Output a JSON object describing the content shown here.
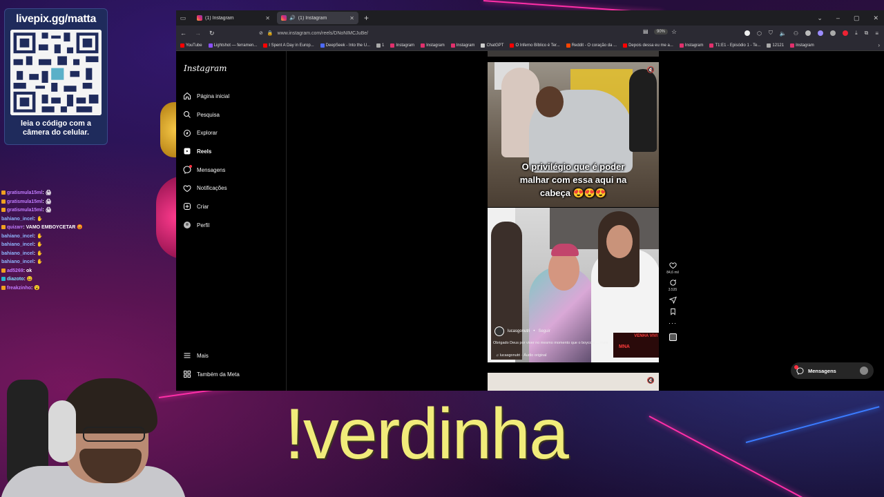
{
  "qr_panel": {
    "url": "livepix.gg/matta",
    "caption": "leia o código com a câmera do celular."
  },
  "chat": [
    {
      "user": "gratismula15ml",
      "sep": ": ",
      "msg": "🖨",
      "color": "purple"
    },
    {
      "user": "gratismula15ml",
      "sep": ": ",
      "msg": "🖨",
      "color": "purple"
    },
    {
      "user": "gratismula15ml",
      "sep": ": ",
      "msg": "🖨",
      "color": "purple"
    },
    {
      "user": "bahiano_incel",
      "sep": ": ",
      "msg": "✋",
      "color": "blue"
    },
    {
      "user": "quizarr",
      "sep": ": ",
      "msg": "VAMO EMBOYCETAR 😡",
      "color": "purple"
    },
    {
      "user": "bahiano_incel",
      "sep": ": ",
      "msg": "✋",
      "color": "blue"
    },
    {
      "user": "bahiano_incel",
      "sep": ": ",
      "msg": "✋",
      "color": "blue"
    },
    {
      "user": "bahiano_incel",
      "sep": ": ",
      "msg": "✋",
      "color": "blue"
    },
    {
      "user": "bahiano_incel",
      "sep": ": ",
      "msg": "✋",
      "color": "blue"
    },
    {
      "user": "ad5269",
      "sep": ": ",
      "msg": "ok",
      "color": "purple"
    },
    {
      "user": "diazoto",
      "sep": ": ",
      "msg": "😀",
      "color": "cyan"
    },
    {
      "user": "freakzinho",
      "sep": ": ",
      "msg": "😮",
      "color": "purple"
    }
  ],
  "browser": {
    "tabs": [
      {
        "title": "(1) Instagram",
        "active": false
      },
      {
        "title": "(1) Instagram",
        "active": true
      }
    ],
    "url": "www.instagram.com/reels/DNoNIMCJuBe/",
    "zoom": "90%",
    "bookmarks": [
      {
        "label": "YouTube",
        "color": "#ff0000"
      },
      {
        "label": "Lightshot — ferramen...",
        "color": "#8a4fff"
      },
      {
        "label": "I Spent A Day in Europ...",
        "color": "#ff0000"
      },
      {
        "label": "DeepSeek - Into the U...",
        "color": "#4d6bfe"
      },
      {
        "label": "1",
        "color": "#aaaaaa"
      },
      {
        "label": "Instagram",
        "color": "#e1306c"
      },
      {
        "label": "Instagram",
        "color": "#e1306c"
      },
      {
        "label": "Instagram",
        "color": "#e1306c"
      },
      {
        "label": "ChatGPT",
        "color": "#cccccc"
      },
      {
        "label": "O Inferno Bíblico é Ter...",
        "color": "#ff0000"
      },
      {
        "label": "Reddit - O coração da ...",
        "color": "#ff4500"
      },
      {
        "label": "Depois dessa eu me a...",
        "color": "#ff0000"
      },
      {
        "label": "Instagram",
        "color": "#e1306c"
      },
      {
        "label": "T1:E1 - Episódio 1 - Te...",
        "color": "#e1306c"
      },
      {
        "label": "12121",
        "color": "#aaaaaa"
      },
      {
        "label": "Instagram",
        "color": "#e1306c"
      }
    ]
  },
  "instagram": {
    "logo": "Instagram",
    "nav": [
      {
        "label": "Página inicial",
        "icon": "home-icon"
      },
      {
        "label": "Pesquisa",
        "icon": "search-icon"
      },
      {
        "label": "Explorar",
        "icon": "compass-icon"
      },
      {
        "label": "Reels",
        "icon": "reels-icon",
        "bold": true
      },
      {
        "label": "Mensagens",
        "icon": "messenger-icon"
      },
      {
        "label": "Notificações",
        "icon": "heart-icon"
      },
      {
        "label": "Criar",
        "icon": "plus-icon"
      },
      {
        "label": "Perfil",
        "icon": "avatar-icon"
      }
    ],
    "bottom_nav": [
      {
        "label": "Mais",
        "icon": "menu-icon"
      },
      {
        "label": "Também da Meta",
        "icon": "meta-icon"
      }
    ],
    "reel_gym": {
      "caption_lines": [
        "O privilégio que é poder",
        "malhar com essa aqui na",
        "cabeça 😍😍😍"
      ]
    },
    "reel_main": {
      "author": "lucasgonutri",
      "follow": "Seguir",
      "description": "Obrigado Deus por viver no mesmo momento que o boycota ... mais",
      "audio": "lucasgonutri · Áudio original",
      "badge_top": "VENHA VIVI",
      "badge_bottom": "MNA"
    },
    "actions": {
      "likes": "84,6 mil",
      "comments": "3.535"
    },
    "messages_button": "Mensagens"
  },
  "overlay": {
    "command": "!verdinha"
  }
}
